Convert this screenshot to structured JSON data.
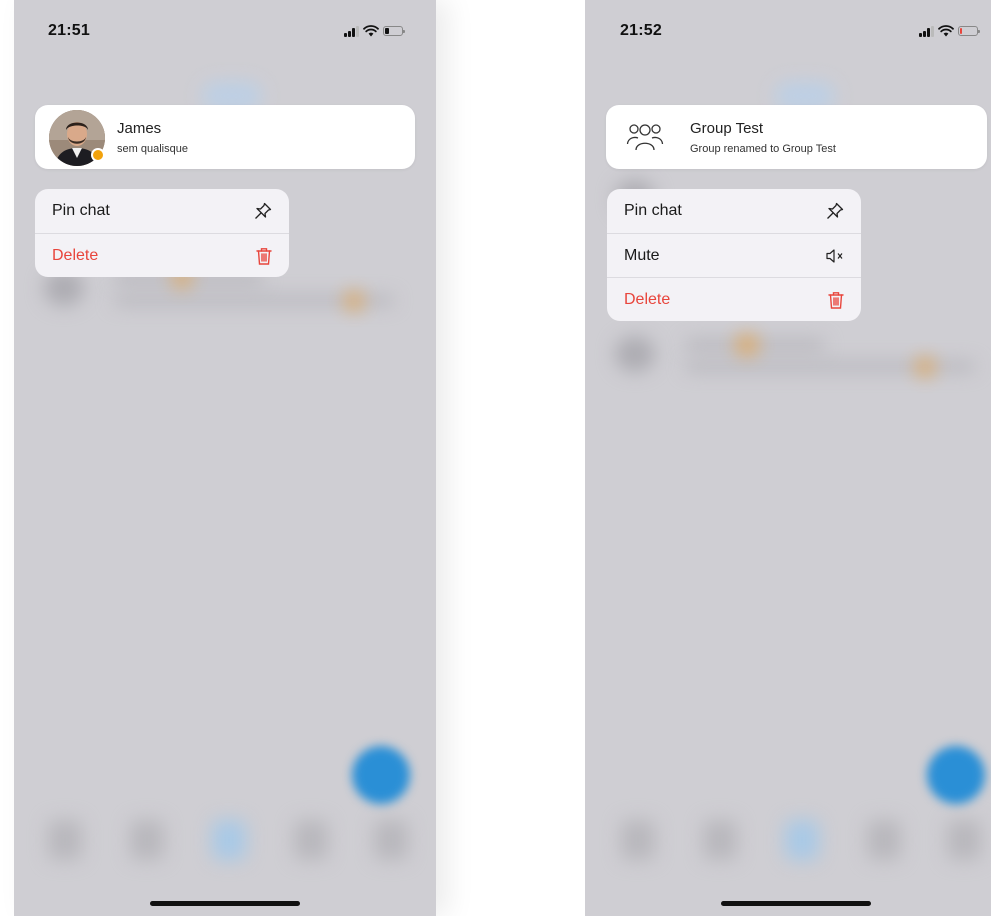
{
  "screens": [
    {
      "status": {
        "time": "21:51",
        "battery_color": "#111111",
        "battery_level": 0.25
      },
      "chat": {
        "name": "James",
        "subtitle": "sem qualisque",
        "avatar": "contact-photo",
        "presence_color": "#f2a20c"
      },
      "menu": [
        {
          "label": "Pin chat",
          "icon": "pin-icon",
          "danger": false
        },
        {
          "label": "Delete",
          "icon": "trash-icon",
          "danger": true
        }
      ]
    },
    {
      "status": {
        "time": "21:52",
        "battery_color": "#e8453c",
        "battery_level": 0.12
      },
      "chat": {
        "name": "Group Test",
        "subtitle": "Group renamed to Group Test",
        "avatar": "group-icon"
      },
      "menu": [
        {
          "label": "Pin chat",
          "icon": "pin-icon",
          "danger": false
        },
        {
          "label": "Mute",
          "icon": "speaker-mute-icon",
          "danger": false
        },
        {
          "label": "Delete",
          "icon": "trash-icon",
          "danger": true
        }
      ]
    }
  ],
  "colors": {
    "danger": "#e8453c",
    "fab": "#2a8fd6",
    "background": "#cfced3"
  }
}
